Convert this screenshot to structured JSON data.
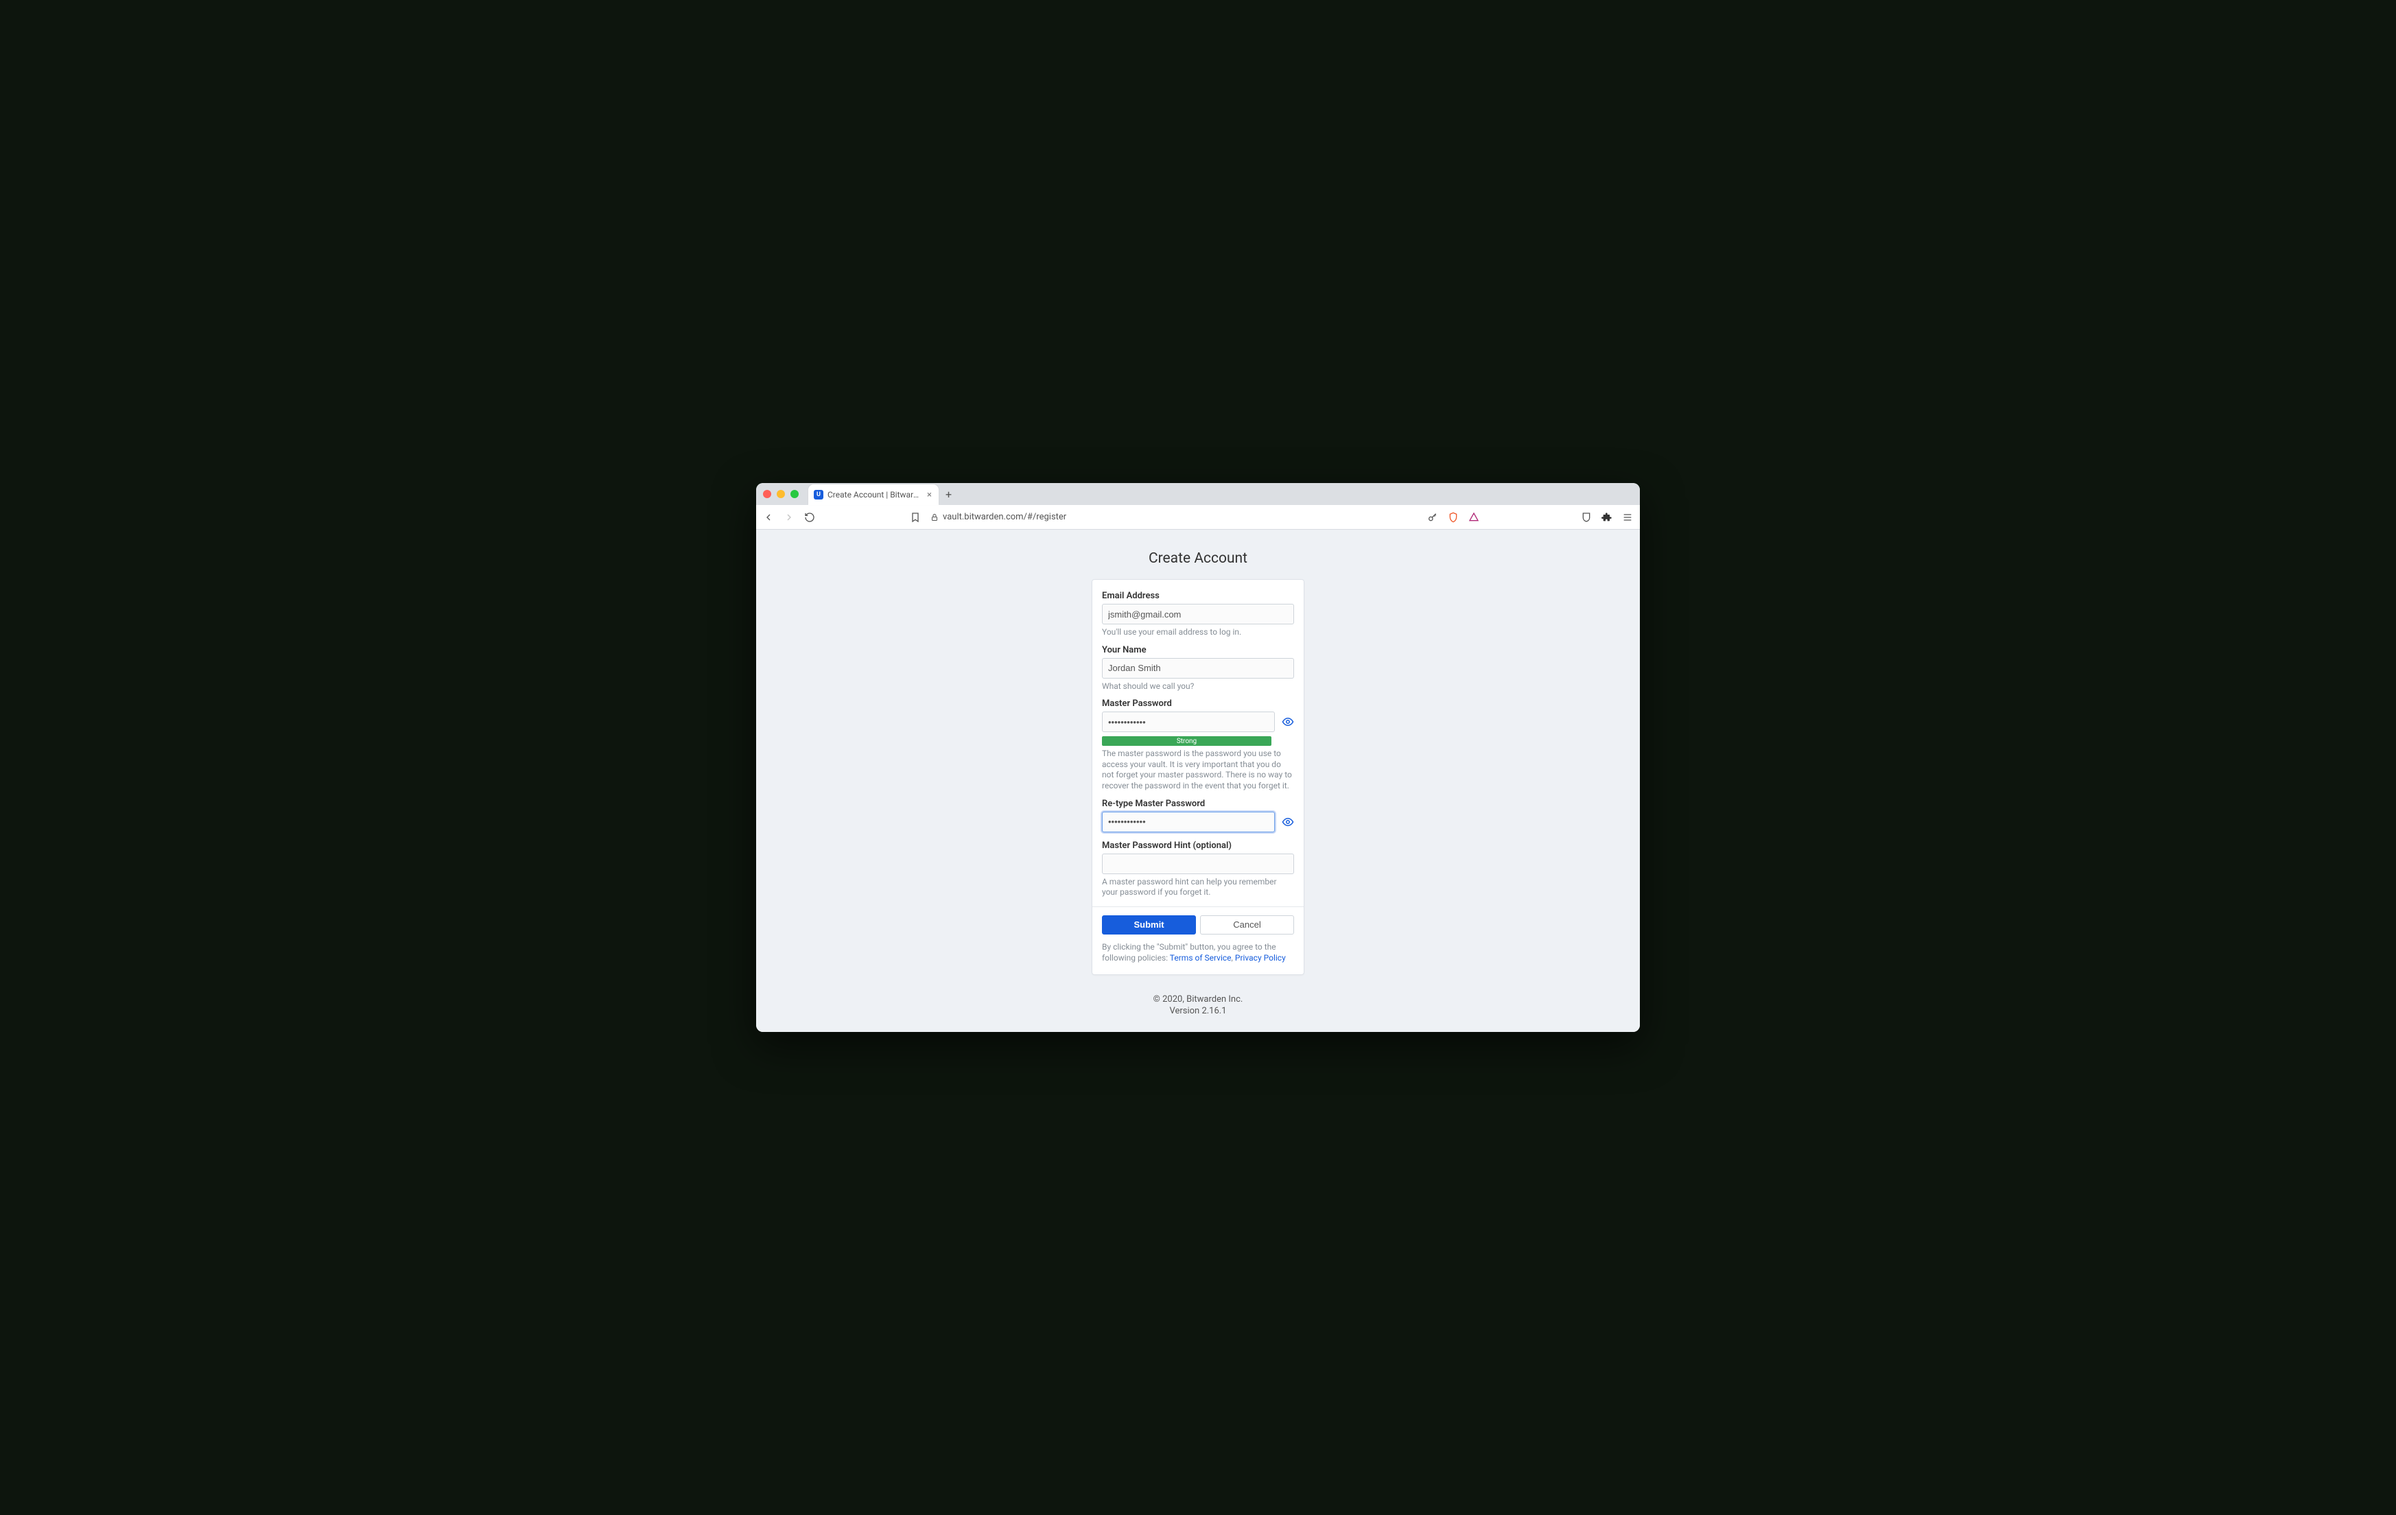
{
  "browser": {
    "tab_title": "Create Account | Bitwarden Web",
    "url": "vault.bitwarden.com/#/register"
  },
  "page": {
    "title": "Create Account"
  },
  "form": {
    "email": {
      "label": "Email Address",
      "value": "jsmith@gmail.com",
      "hint": "You'll use your email address to log in."
    },
    "name": {
      "label": "Your Name",
      "value": "Jordan Smith",
      "hint": "What should we call you?"
    },
    "master_password": {
      "label": "Master Password",
      "value": "••••••••••••",
      "strength": "Strong",
      "hint": "The master password is the password you use to access your vault. It is very important that you do not forget your master password. There is no way to recover the password in the event that you forget it."
    },
    "retype": {
      "label": "Re-type Master Password",
      "value": "••••••••••••"
    },
    "hint_field": {
      "label": "Master Password Hint (optional)",
      "value": "",
      "hint": "A master password hint can help you remember your password if you forget it."
    },
    "buttons": {
      "submit": "Submit",
      "cancel": "Cancel"
    },
    "legal": {
      "prefix": "By clicking the \"Submit\" button, you agree to the following policies: ",
      "tos": "Terms of Service",
      "sep": ", ",
      "privacy": "Privacy Policy"
    }
  },
  "footer": {
    "copyright": "© 2020, Bitwarden Inc.",
    "version": "Version 2.16.1"
  }
}
